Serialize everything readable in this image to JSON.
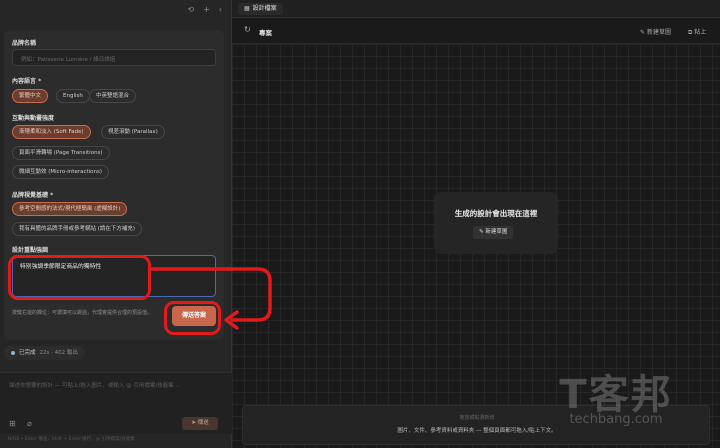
{
  "left_panel": {
    "top_icons": [
      "history-icon",
      "plus-icon",
      "collapse-icon"
    ],
    "form": {
      "brand_name_label": "品牌名稱",
      "brand_name_placeholder": "例如：Patisserie Lumière / 綠日烘焙",
      "language_label": "內容語言 *",
      "language_options": [
        {
          "label": "繁體中文",
          "selected": true
        },
        {
          "label": "English",
          "selected": false
        },
        {
          "label": "中英雙語混合",
          "selected": false
        }
      ],
      "animation_label": "互動與動畫強度",
      "animation_options": [
        {
          "label": "漸隱柔和淡入 (Soft Fade)",
          "selected": true
        },
        {
          "label": "視差滾動 (Parallax)",
          "selected": false
        },
        {
          "label": "頁面平滑轉場 (Page Transitions)",
          "selected": false
        },
        {
          "label": "微細互動效 (Micro-interactions)",
          "selected": false
        }
      ],
      "visual_label": "品牌視覺基礎 *",
      "visual_options": [
        {
          "label": "參考空間感的法式/現代極簡風 (虛擬設計)",
          "selected": true
        },
        {
          "label": "我有具體的品牌手冊或參考網站 (請在下方補充)",
          "selected": false
        }
      ],
      "focus_label": "設計重點強調",
      "focus_value": "特別強調季節限定商品的獨特性",
      "hint": "按鍵右邊的欄位：可選填可以跳過，代理會提供合理的預設值。",
      "submit_label": "傳送答案"
    },
    "status": {
      "label": "已完成",
      "meta": "22s · 402 輸出"
    },
    "composer": {
      "placeholder": "描述你想要的設計 — 可貼上/拖入圖片、或輸入 @ 引用檔案/技能集…",
      "send_label": "傳送"
    },
    "footer": "N/OS • Enter 傳送，Shift + Enter 換行，@ 引用檔案/技能集"
  },
  "right_panel": {
    "tab_label": "設計檔案",
    "toolbar": {
      "title": "專案",
      "new_draft": "新建草圖",
      "copy": "粘上"
    },
    "empty_state": {
      "title": "生成的設計會出現在這裡",
      "button": "新建草圖"
    },
    "dropzone": {
      "line1": "拖放或點選新增",
      "line2": "圖片、文件、參考資料或資料夾 — 整個頁面都可拖入/貼上下文。"
    }
  },
  "watermark": {
    "cn": "T客邦",
    "en": "techbang.com"
  },
  "colors": {
    "accent": "#c9674d",
    "annotation": "#e21a1a",
    "focus_border": "#4968b8"
  }
}
